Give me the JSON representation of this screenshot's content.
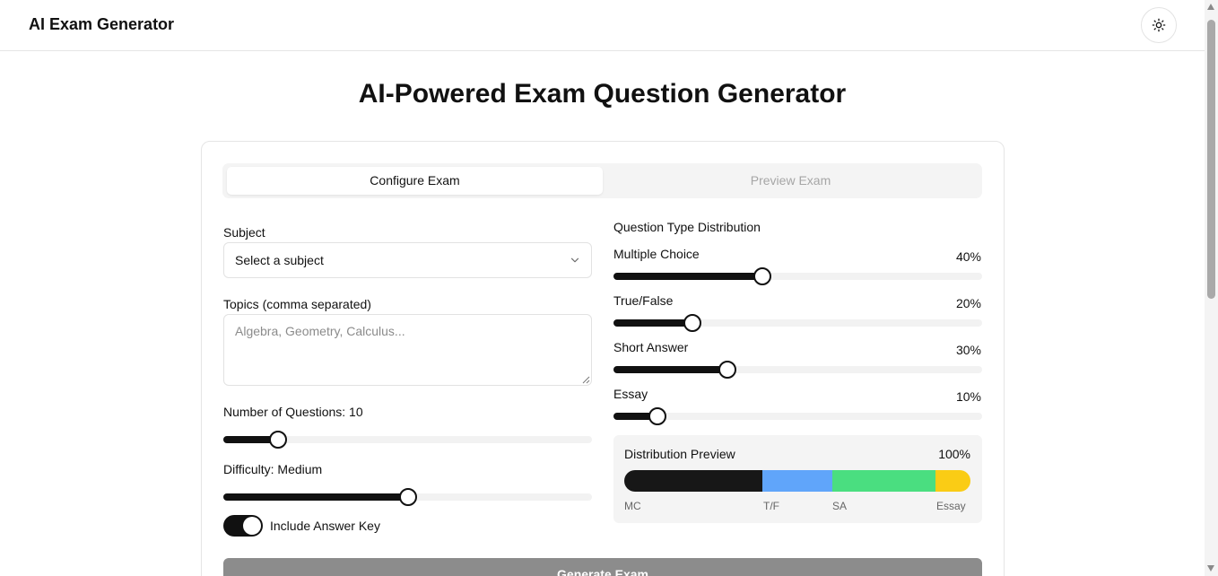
{
  "header": {
    "app_title": "AI Exam Generator",
    "theme_icon": "sun-icon"
  },
  "main": {
    "heading": "AI-Powered Exam Question Generator"
  },
  "tabs": [
    {
      "label": "Configure Exam",
      "active": true
    },
    {
      "label": "Preview Exam",
      "active": false
    }
  ],
  "form": {
    "subject_label": "Subject",
    "subject_value": "Select a subject",
    "topics_label": "Topics (comma separated)",
    "topics_placeholder": "Algebra, Geometry, Calculus...",
    "topics_value": "",
    "num_questions_label": "Number of Questions: 10",
    "num_questions": {
      "value": 10,
      "fraction": 0.13
    },
    "difficulty_label": "Difficulty: Medium",
    "difficulty": {
      "value": "Medium",
      "fraction": 0.5
    },
    "answer_key_label": "Include Answer Key",
    "answer_key_on": true
  },
  "distribution": {
    "title": "Question Type Distribution",
    "types": [
      {
        "label": "Multiple Choice",
        "percent_label": "40%",
        "percent": 40
      },
      {
        "label": "True/False",
        "percent_label": "20%",
        "percent": 20
      },
      {
        "label": "Short Answer",
        "percent_label": "30%",
        "percent": 30
      },
      {
        "label": "Essay",
        "percent_label": "10%",
        "percent": 10
      }
    ],
    "preview": {
      "title": "Distribution Preview",
      "total_label": "100%",
      "segments": [
        {
          "label": "MC",
          "percent": 40,
          "color": "#171717"
        },
        {
          "label": "T/F",
          "percent": 20,
          "color": "#60a5fa"
        },
        {
          "label": "SA",
          "percent": 30,
          "color": "#4ade80"
        },
        {
          "label": "Essay",
          "percent": 10,
          "color": "#facc15"
        }
      ]
    }
  },
  "actions": {
    "generate_label": "Generate Exam"
  }
}
